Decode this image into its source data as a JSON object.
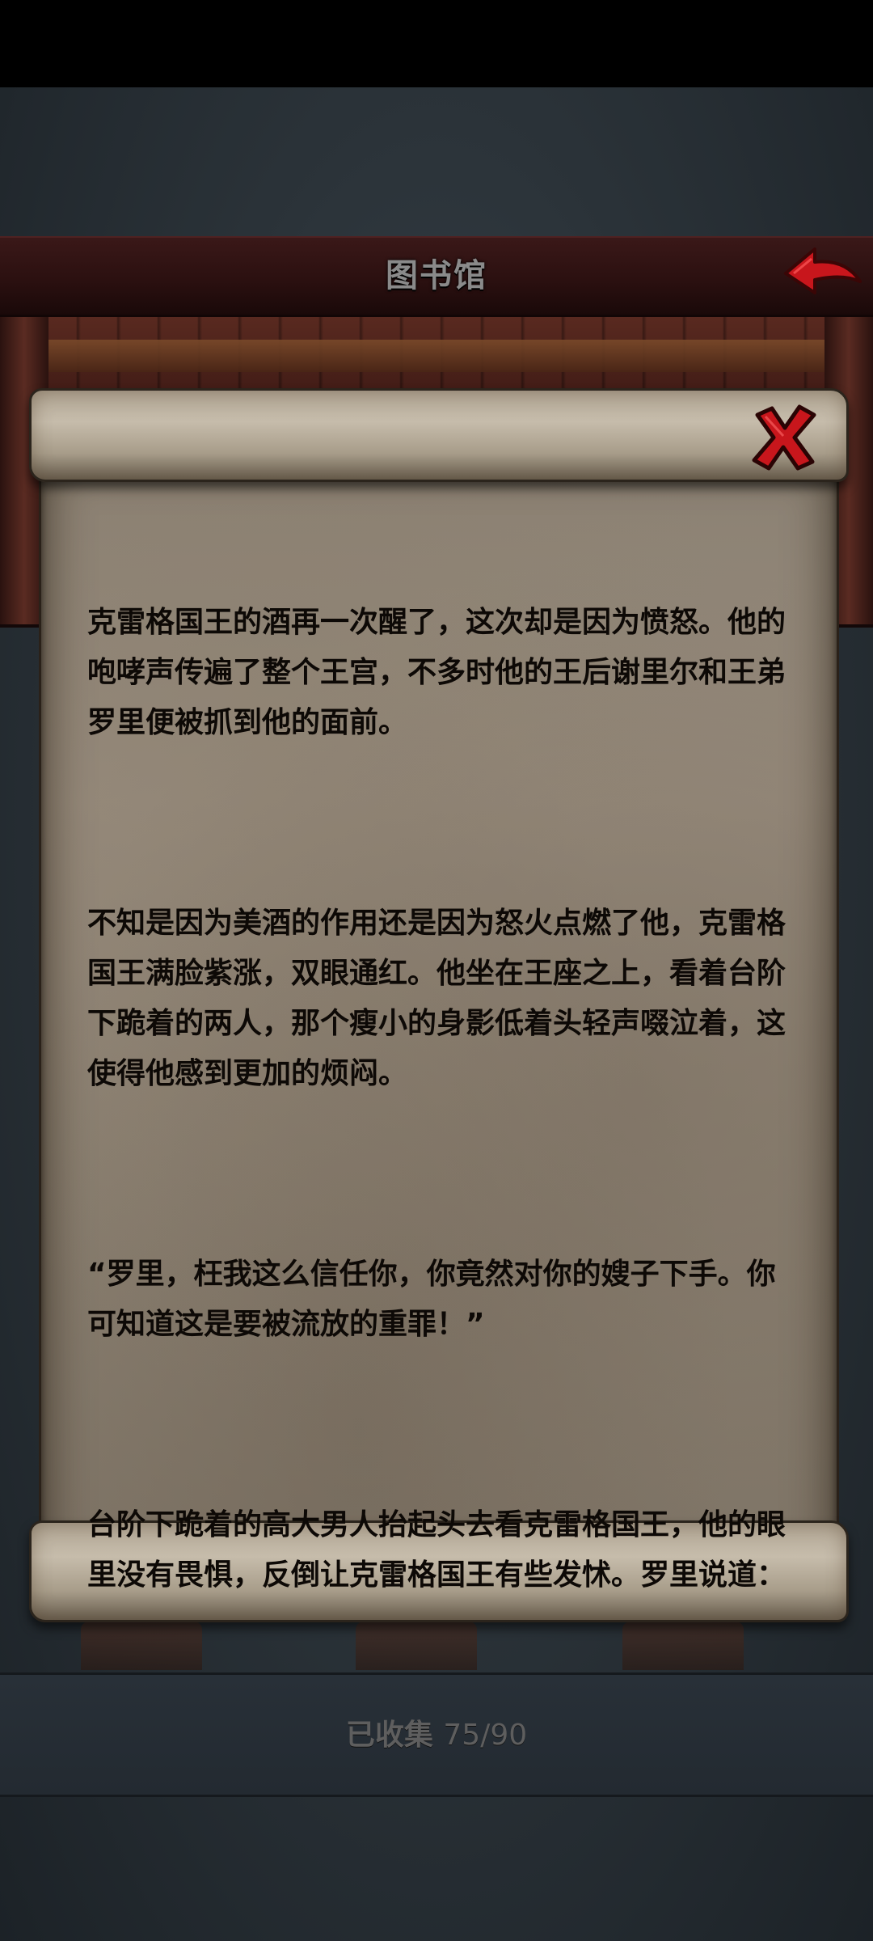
{
  "header": {
    "title": "图书馆",
    "back_icon": "red-arrow-back-icon"
  },
  "letter": {
    "close_icon": "red-x-close-icon",
    "paragraphs": [
      "克雷格国王的酒再一次醒了，这次却是因为愤怒。他的咆哮声传遍了整个王宫，不多时他的王后谢里尔和王弟罗里便被抓到他的面前。",
      "不知是因为美酒的作用还是因为怒火点燃了他，克雷格国王满脸紫涨，双眼通红。他坐在王座之上，看着台阶下跪着的两人，那个瘦小的身影低着头轻声啜泣着，这使得他感到更加的烦闷。",
      "“罗里，枉我这么信任你，你竟然对你的嫂子下手。你可知道这是要被流放的重罪！”",
      "台阶下跪着的高大男人抬起头去看克雷格国王，他的眼里没有畏惧，反倒让克雷格国王有些发怵。罗里说道："
    ]
  },
  "collection": {
    "label": "已收集",
    "count": "75/90"
  },
  "colors": {
    "header_bg": "#2b1010",
    "parchment": "#8b8173",
    "accent_red": "#c8161c",
    "text": "#0d0906",
    "counter_text": "#5e5e5e"
  }
}
